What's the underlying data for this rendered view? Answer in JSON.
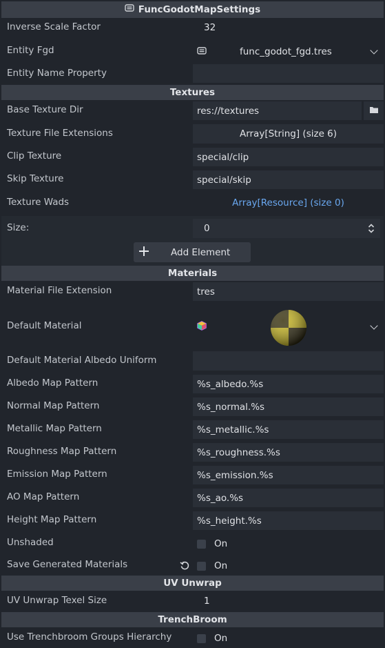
{
  "inspector": {
    "title": "FuncGodotMapSettings",
    "sections": {
      "textures": "Textures",
      "materials": "Materials",
      "uv_unwrap": "UV Unwrap",
      "trenchbroom": "TrenchBroom"
    },
    "properties": {
      "inverse_scale_factor": {
        "label": "Inverse Scale Factor",
        "value": "32"
      },
      "entity_fgd": {
        "label": "Entity Fgd",
        "value": "func_godot_fgd.tres"
      },
      "entity_name_property": {
        "label": "Entity Name Property",
        "value": ""
      },
      "base_texture_dir": {
        "label": "Base Texture Dir",
        "value": "res://textures"
      },
      "texture_file_extensions": {
        "label": "Texture File Extensions",
        "value": "Array[String] (size 6)"
      },
      "clip_texture": {
        "label": "Clip Texture",
        "value": "special/clip"
      },
      "skip_texture": {
        "label": "Skip Texture",
        "value": "special/skip"
      },
      "texture_wads": {
        "label": "Texture Wads",
        "value": "Array[Resource] (size 0)"
      },
      "size": {
        "label": "Size:",
        "value": "0"
      },
      "add_element": {
        "label": "Add Element"
      },
      "material_file_extension": {
        "label": "Material File Extension",
        "value": "tres"
      },
      "default_material": {
        "label": "Default Material"
      },
      "default_material_albedo_uniform": {
        "label": "Default Material Albedo Uniform",
        "value": ""
      },
      "albedo_map_pattern": {
        "label": "Albedo Map Pattern",
        "value": "%s_albedo.%s"
      },
      "normal_map_pattern": {
        "label": "Normal Map Pattern",
        "value": "%s_normal.%s"
      },
      "metallic_map_pattern": {
        "label": "Metallic Map Pattern",
        "value": "%s_metallic.%s"
      },
      "roughness_map_pattern": {
        "label": "Roughness Map Pattern",
        "value": "%s_roughness.%s"
      },
      "emission_map_pattern": {
        "label": "Emission Map Pattern",
        "value": "%s_emission.%s"
      },
      "ao_map_pattern": {
        "label": "AO Map Pattern",
        "value": "%s_ao.%s"
      },
      "height_map_pattern": {
        "label": "Height Map Pattern",
        "value": "%s_height.%s"
      },
      "unshaded": {
        "label": "Unshaded",
        "value": "On",
        "checked": false
      },
      "save_generated_materials": {
        "label": "Save Generated Materials",
        "value": "On",
        "checked": false
      },
      "uv_unwrap_texel_size": {
        "label": "UV Unwrap Texel Size",
        "value": "1"
      },
      "use_trenchbroom_groups_hierarchy": {
        "label": "Use Trenchbroom Groups Hierarchy",
        "value": "On",
        "checked": false
      }
    },
    "icons": [
      "script-resource-icon",
      "chevron-down-icon",
      "folder-icon",
      "spin-arrows-icon",
      "plus-icon",
      "material-cube-icon",
      "revert-icon",
      "checkbox-icon"
    ],
    "colors": {
      "background": "#21252c",
      "section_header": "#3a3f48",
      "field": "#2a2f37",
      "link": "#6aa8f0"
    }
  }
}
